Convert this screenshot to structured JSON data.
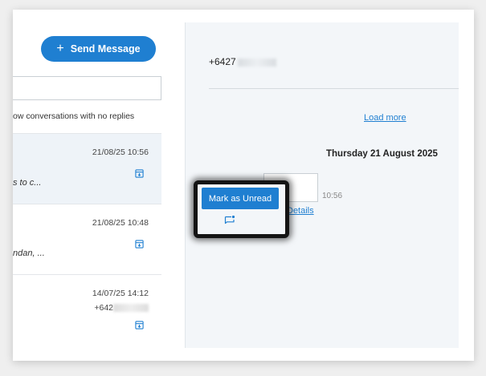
{
  "left": {
    "send_button_label": "Send Message",
    "search_placeholder": "",
    "filter_label": "ow conversations with no replies",
    "conversations": [
      {
        "time": "21/08/25 10:56",
        "preview": "s to c..."
      },
      {
        "time": "21/08/25 10:48",
        "preview": "ndan, ..."
      },
      {
        "time": "14/07/25 14:12",
        "phone": "+642"
      }
    ]
  },
  "right": {
    "phone": "+6427",
    "load_more": "Load more",
    "date_header": "Thursday 21 August 2025",
    "message_time": "10:56",
    "details": "Details"
  },
  "context_menu": {
    "mark_unread": "Mark as Unread"
  },
  "colors": {
    "accent": "#1f7fd1",
    "pane_bg": "#f3f6f9"
  }
}
